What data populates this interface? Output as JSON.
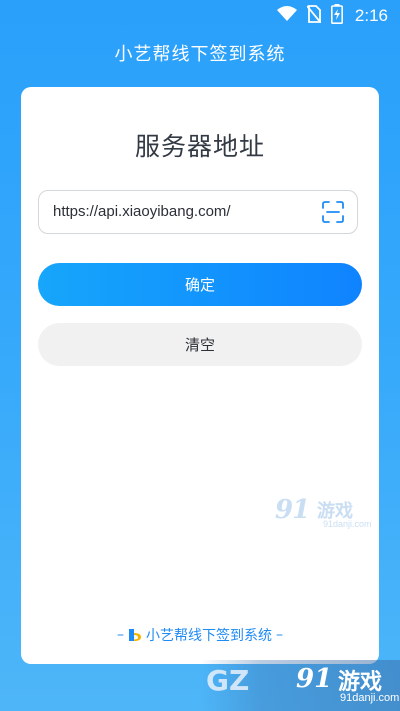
{
  "status_bar": {
    "time": "2:16",
    "icons": [
      "wifi-icon",
      "no-sim-icon",
      "battery-charging-icon"
    ]
  },
  "app": {
    "title": "小艺帮线下签到系统"
  },
  "card": {
    "title": "服务器地址",
    "url_input": {
      "value": "https://api.xiaoyibang.com/",
      "placeholder": ""
    },
    "scan_icon": "scan-icon",
    "confirm_label": "确定",
    "clear_label": "清空",
    "footer_brand": "小艺帮线下签到系统",
    "footer_dash_left": "–",
    "footer_dash_right": "–"
  },
  "watermark_card": {
    "big": "91",
    "cn": "游戏",
    "sub": "91danji.com"
  },
  "watermark_bottom": {
    "left": "GZ",
    "big": "91",
    "cn": "游戏",
    "domain": "91danji.com"
  },
  "colors": {
    "background": "#34a8fb",
    "accent": "#0f83ff",
    "brand_text": "#1f8bf5"
  }
}
